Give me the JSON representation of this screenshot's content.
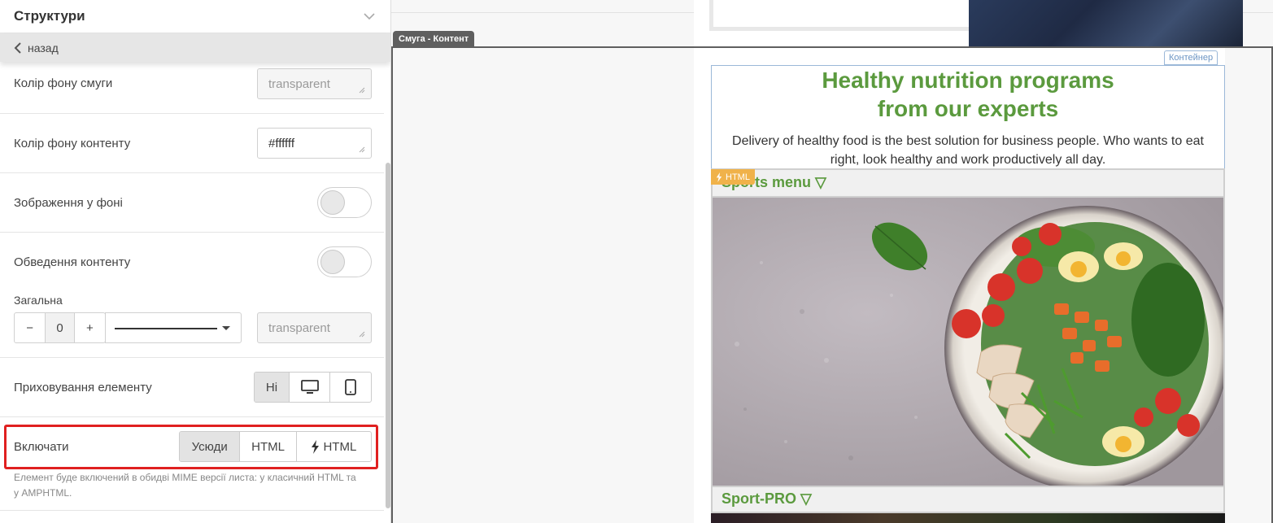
{
  "panel": {
    "title": "Структури",
    "back": "назад",
    "rows": {
      "band_bg_label": "Колір фону смуги",
      "band_bg_value": "transparent",
      "content_bg_label": "Колір фону контенту",
      "content_bg_value": "#ffffff",
      "bg_image_label": "Зображення у фоні",
      "border_label": "Обведення контенту",
      "general_label": "Загальна",
      "border_width": "0",
      "border_color_value": "transparent",
      "hide_label": "Приховування елементу",
      "hide_no": "Ні",
      "include_label": "Включати",
      "include_everywhere": "Усюди",
      "include_html": "HTML",
      "include_amp": "HTML"
    },
    "hint": "Елемент буде включений в обидві MIME версії листа: у класичний HTML та у AMPHTML."
  },
  "canvas": {
    "band_tab": "Смуга - Контент",
    "container_label": "Контейнер",
    "headline_line1": "Healthy nutrition programs",
    "headline_line2": "from our experts",
    "lead": "Delivery of healthy food is the best solution for business people. Who wants to eat right, look healthy and work productively all day.",
    "html_tag": "HTML",
    "menu1": "Sports menu ▽",
    "menu2": "Sport-PRO ▽"
  },
  "colors": {
    "accent_green": "#5b9a3e",
    "highlight_red": "#e02020",
    "container_blue": "#9bb8d8",
    "amp_tag": "#f0b24a"
  }
}
